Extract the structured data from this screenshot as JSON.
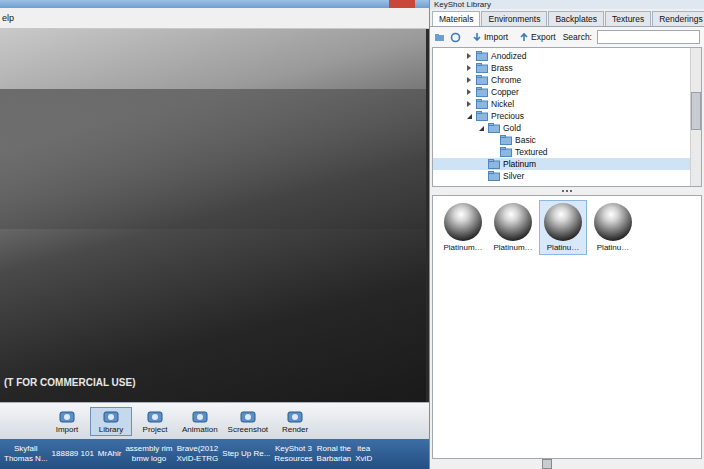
{
  "main_window": {
    "menu_fragment": "elp",
    "viewport_watermark": "(T FOR COMMERCIAL USE)",
    "toolbar": [
      {
        "label": "Import",
        "selected": false
      },
      {
        "label": "Library",
        "selected": true
      },
      {
        "label": "Project",
        "selected": false
      },
      {
        "label": "Animation",
        "selected": false
      },
      {
        "label": "Screenshot",
        "selected": false
      },
      {
        "label": "Render",
        "selected": false
      }
    ]
  },
  "taskbar": [
    {
      "lines": [
        "Skyfall",
        "Thomas N..."
      ]
    },
    {
      "lines": [
        "188889 101"
      ]
    },
    {
      "lines": [
        "MrAhir"
      ]
    },
    {
      "lines": [
        "assembly rim",
        "bmw logo"
      ]
    },
    {
      "lines": [
        "Brave(2012",
        "XviD-ETRG"
      ]
    },
    {
      "lines": [
        "Step Up Re..."
      ]
    },
    {
      "lines": [
        "KeyShot 3",
        "Resources"
      ]
    },
    {
      "lines": [
        "Ronal the",
        "Barbarian"
      ]
    },
    {
      "lines": [
        "itea",
        "XviD"
      ]
    }
  ],
  "library": {
    "title": "KeyShot Library",
    "tabs": [
      {
        "label": "Materials",
        "selected": true
      },
      {
        "label": "Environments",
        "selected": false
      },
      {
        "label": "Backplates",
        "selected": false
      },
      {
        "label": "Textures",
        "selected": false
      },
      {
        "label": "Renderings",
        "selected": false
      }
    ],
    "toolbar": {
      "import": "Import",
      "export": "Export",
      "search_label": "Search:"
    },
    "tree": [
      {
        "label": "Anodized",
        "depth": 0,
        "expandable": true,
        "expanded": false,
        "selected": false
      },
      {
        "label": "Brass",
        "depth": 0,
        "expandable": true,
        "expanded": false,
        "selected": false
      },
      {
        "label": "Chrome",
        "depth": 0,
        "expandable": true,
        "expanded": false,
        "selected": false
      },
      {
        "label": "Copper",
        "depth": 0,
        "expandable": true,
        "expanded": false,
        "selected": false
      },
      {
        "label": "Nickel",
        "depth": 0,
        "expandable": true,
        "expanded": false,
        "selected": false
      },
      {
        "label": "Precious",
        "depth": 0,
        "expandable": true,
        "expanded": true,
        "selected": false
      },
      {
        "label": "Gold",
        "depth": 1,
        "expandable": true,
        "expanded": true,
        "selected": false
      },
      {
        "label": "Basic",
        "depth": 2,
        "expandable": false,
        "expanded": false,
        "selected": false
      },
      {
        "label": "Textured",
        "depth": 2,
        "expandable": false,
        "expanded": false,
        "selected": false
      },
      {
        "label": "Platinum",
        "depth": 1,
        "expandable": false,
        "expanded": false,
        "selected": true
      },
      {
        "label": "Silver",
        "depth": 1,
        "expandable": false,
        "expanded": false,
        "selected": false
      }
    ],
    "thumbnails": [
      {
        "label": "Platinum…",
        "selected": false
      },
      {
        "label": "Platinum…",
        "selected": false
      },
      {
        "label": "Platinu…",
        "selected": true
      },
      {
        "label": "Platinu…",
        "selected": false
      }
    ]
  }
}
